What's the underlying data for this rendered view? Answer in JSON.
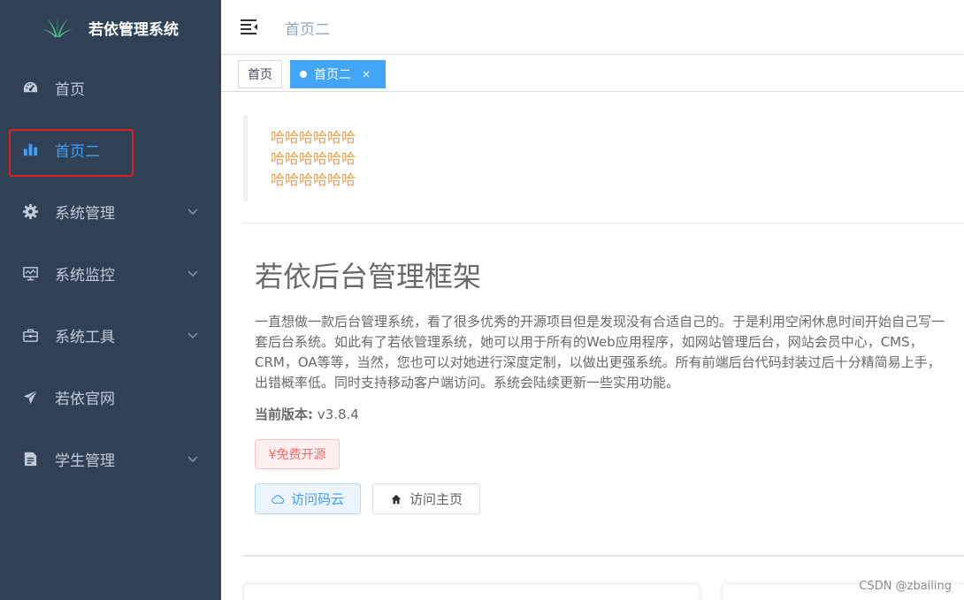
{
  "sidebar": {
    "logo_title": "若依管理系统",
    "items": [
      {
        "label": "首页",
        "icon": "dashboard-icon",
        "has_children": false,
        "active": false
      },
      {
        "label": "首页二",
        "icon": "bar-chart-icon",
        "has_children": false,
        "active": true
      },
      {
        "label": "系统管理",
        "icon": "gear-icon",
        "has_children": true,
        "active": false
      },
      {
        "label": "系统监控",
        "icon": "monitor-icon",
        "has_children": true,
        "active": false
      },
      {
        "label": "系统工具",
        "icon": "toolbox-icon",
        "has_children": true,
        "active": false
      },
      {
        "label": "若依官网",
        "icon": "paper-plane-icon",
        "has_children": false,
        "active": false
      },
      {
        "label": "学生管理",
        "icon": "document-icon",
        "has_children": true,
        "active": false
      }
    ],
    "colors": {
      "background": "#304156",
      "text": "#bfcbd9",
      "active": "#409eff",
      "highlight_box": "#e02020"
    }
  },
  "header": {
    "breadcrumb": "首页二"
  },
  "tags": [
    {
      "label": "首页",
      "active": false
    },
    {
      "label": "首页二",
      "active": true,
      "close": "×"
    }
  ],
  "main": {
    "quote_lines": [
      "哈哈哈哈哈哈",
      "哈哈哈哈哈哈",
      "哈哈哈哈哈哈"
    ],
    "title": "若依后台管理框架",
    "description": "一直想做一款后台管理系统，看了很多优秀的开源项目但是发现没有合适自己的。于是利用空闲休息时间开始自己写一套后台系统。如此有了若依管理系统，她可以用于所有的Web应用程序，如网站管理后台，网站会员中心，CMS，CRM，OA等等，当然，您也可以对她进行深度定制，以做出更强系统。所有前端后台代码封装过后十分精简易上手，出错概率低。同时支持移动客户端访问。系统会陆续更新一些实用功能。",
    "version_label": "当前版本:",
    "version_value": " v3.8.4",
    "free_tag": "¥免费开源",
    "btn_gitee": "访问码云",
    "btn_home": "访问主页"
  },
  "watermark": "CSDN @zbailing"
}
